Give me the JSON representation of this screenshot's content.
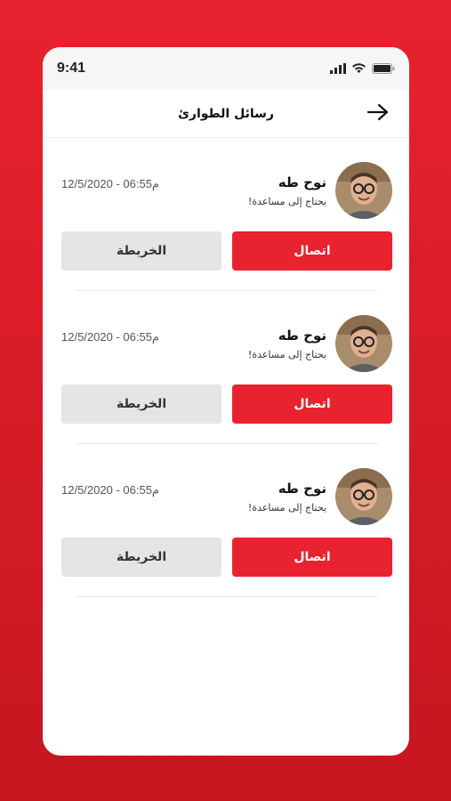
{
  "status_bar": {
    "time": "9:41"
  },
  "header": {
    "title": "رسائل الطوارئ",
    "back_icon": "arrow-right-icon"
  },
  "colors": {
    "accent": "#e8222f",
    "map_button": "#e5e5e5"
  },
  "alerts": [
    {
      "name": "نوح طه",
      "message": "يحتاج إلى مساعدة!",
      "datetime": "12/5/2020 - 06:55م",
      "call_label": "اتصال",
      "map_label": "الخريطة"
    },
    {
      "name": "نوح طه",
      "message": "يحتاج إلى مساعدة!",
      "datetime": "12/5/2020 - 06:55م",
      "call_label": "اتصال",
      "map_label": "الخريطة"
    },
    {
      "name": "نوح طه",
      "message": "يحتاج إلى مساعدة!",
      "datetime": "12/5/2020 - 06:55م",
      "call_label": "اتصال",
      "map_label": "الخريطة"
    }
  ]
}
